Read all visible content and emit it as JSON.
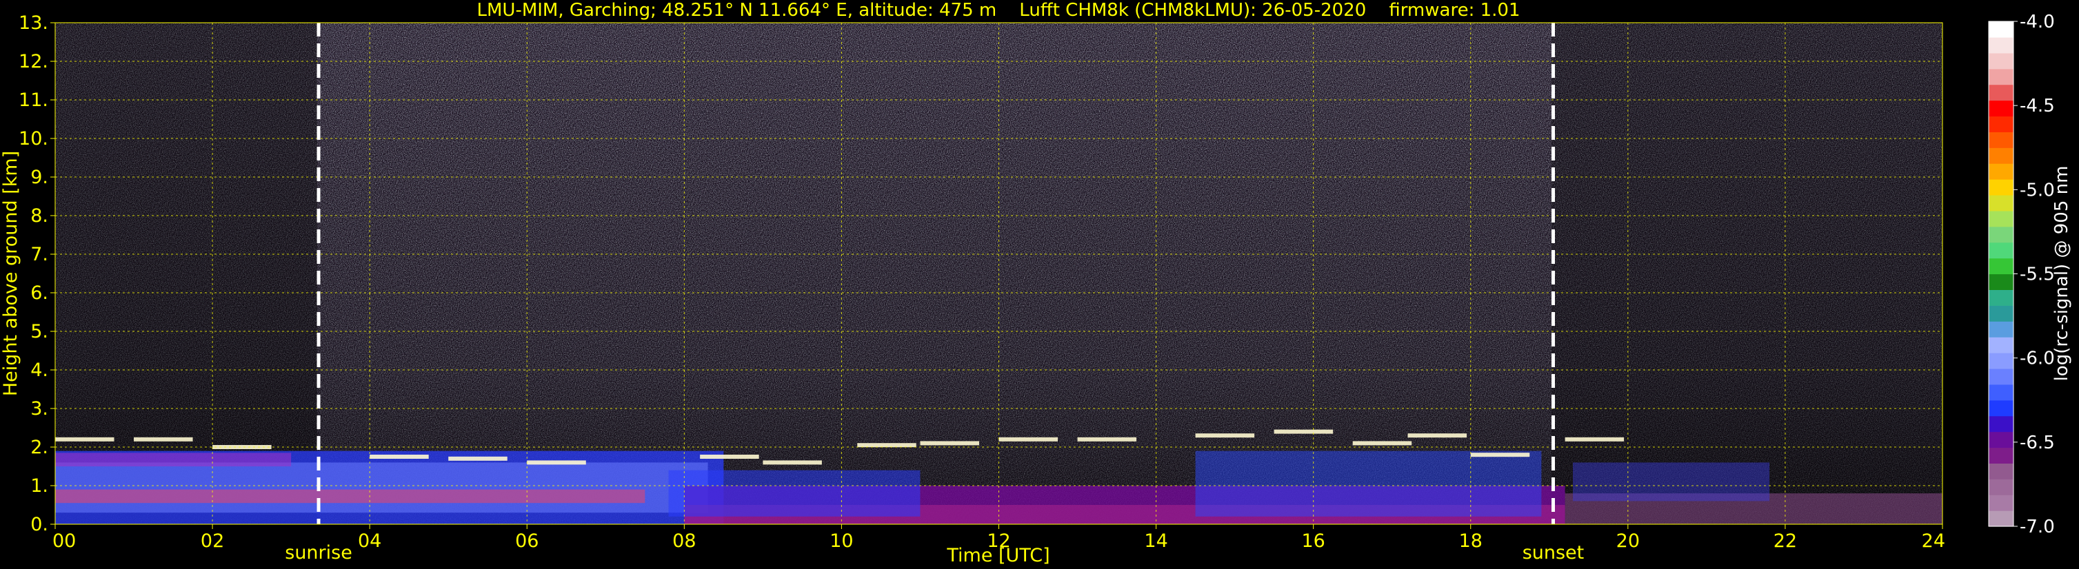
{
  "chart_data": {
    "type": "heatmap",
    "title": "LMU-MIM, Garching; 48.251° N 11.664° E, altitude: 475 m    Lufft CHM8k (CHM8kLMU): 26-05-2020    firmware: 1.01",
    "xlabel": "Time [UTC]",
    "ylabel": "Height above ground [km]",
    "x_ticks": [
      "00",
      "02",
      "04",
      "06",
      "08",
      "10",
      "12",
      "14",
      "16",
      "18",
      "20",
      "22",
      "24"
    ],
    "y_ticks": [
      "0.",
      "1.",
      "2.",
      "3.",
      "4.",
      "5.",
      "6.",
      "7.",
      "8.",
      "9.",
      "10.",
      "11.",
      "12.",
      "13."
    ],
    "xlim": [
      0,
      24
    ],
    "ylim": [
      0,
      13
    ],
    "grid": true,
    "annotations": [
      {
        "label": "sunrise",
        "x": 3.35
      },
      {
        "label": "sunset",
        "x": 19.05
      }
    ],
    "colorbar": {
      "label": "log(rc-signal) @ 905 nm",
      "range": [
        -7.0,
        -4.0
      ],
      "ticks": [
        "-4.0",
        "-4.5",
        "-5.0",
        "-5.5",
        "-6.0",
        "-6.5",
        "-7.0"
      ],
      "colors": [
        "#b79bb5",
        "#a87ba6",
        "#9d6a9a",
        "#925a8f",
        "#7e1d8a",
        "#6a0e9a",
        "#3b10c8",
        "#1f3cff",
        "#3f5fff",
        "#6a80ff",
        "#8a9cff",
        "#a2b2ff",
        "#5a9de0",
        "#2a9a9a",
        "#2eaf8a",
        "#1a8a1a",
        "#36c636",
        "#50d87a",
        "#7ad67a",
        "#a6e25a",
        "#d8e02a",
        "#ffd200",
        "#ffa800",
        "#ff8000",
        "#ff5a00",
        "#ff2a00",
        "#ff0000",
        "#e85a5a",
        "#f0a4a4",
        "#f4c8c8",
        "#f8e4e4",
        "#ffffff"
      ]
    },
    "cloud_layers": [
      {
        "x": 0.0,
        "y": 2.2
      },
      {
        "x": 1.0,
        "y": 2.2
      },
      {
        "x": 2.0,
        "y": 2.0
      },
      {
        "x": 4.0,
        "y": 1.75
      },
      {
        "x": 5.0,
        "y": 1.7
      },
      {
        "x": 6.0,
        "y": 1.6
      },
      {
        "x": 8.2,
        "y": 1.75
      },
      {
        "x": 9.0,
        "y": 1.6
      },
      {
        "x": 10.2,
        "y": 2.05
      },
      {
        "x": 11.0,
        "y": 2.1
      },
      {
        "x": 12.0,
        "y": 2.2
      },
      {
        "x": 13.0,
        "y": 2.2
      },
      {
        "x": 14.5,
        "y": 2.3
      },
      {
        "x": 15.5,
        "y": 2.4
      },
      {
        "x": 16.5,
        "y": 2.1
      },
      {
        "x": 17.2,
        "y": 2.3
      },
      {
        "x": 18.0,
        "y": 1.8
      },
      {
        "x": 19.2,
        "y": 2.2
      }
    ]
  }
}
